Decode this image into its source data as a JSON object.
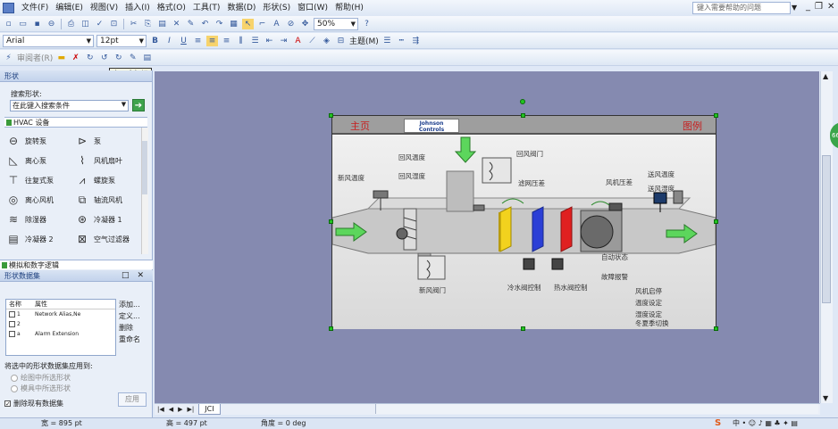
{
  "menubar": {
    "items": [
      "文件(F)",
      "编辑(E)",
      "视图(V)",
      "插入(I)",
      "格式(O)",
      "工具(T)",
      "数据(D)",
      "形状(S)",
      "窗口(W)",
      "帮助(H)"
    ],
    "help_placeholder": "键入需要帮助的问题"
  },
  "toolbar": {
    "zoom": "50%",
    "font": "Arial",
    "font_size": "12pt",
    "theme_label": "主题(M)",
    "review_label": "审阅者(R)",
    "tooltip": "上一个标记"
  },
  "shapes_pane": {
    "title": "形状",
    "search_label": "搜索形状:",
    "search_placeholder": "在此键入搜索条件",
    "stencil_title": "HVAC 设备",
    "items": [
      "旋转泵",
      "泵",
      "离心泵",
      "风机扇叶",
      "往复式泵",
      "螺旋泵",
      "离心风机",
      "轴流风机",
      "除湿器",
      "冷凝器 1",
      "冷凝器 2",
      "空气过滤器"
    ],
    "logic_title": "模拟和数字逻辑"
  },
  "datasets_pane": {
    "title": "形状数据集",
    "col_name": "名称",
    "col_prop": "属性",
    "rows": [
      {
        "name": "1",
        "prop": "Network Alias,Ne"
      },
      {
        "name": "2",
        "prop": ""
      },
      {
        "name": "a",
        "prop": "Alarm Extension"
      }
    ],
    "actions": [
      "添加...",
      "定义...",
      "删除",
      "重命名"
    ],
    "apply_label": "将选中的形状数据集应用到:",
    "opt_selected": "绘图中所选形状",
    "opt_stencil": "模具中所选形状",
    "delete_existing": "删除现有数据集",
    "apply_button": "应用"
  },
  "sheet_tab": "JCI",
  "status": {
    "width": "宽 = 895 pt",
    "height": "高 = 497 pt",
    "angle": "角度 = 0 deg"
  },
  "diagram": {
    "home": "主页",
    "legend": "图例",
    "logo_line1": "Johnson",
    "logo_line2": "Controls",
    "labels": {
      "return_temp": "回风温度",
      "return_humidity": "回风湿度",
      "fresh_temp": "新风温度",
      "return_damper": "回风阀门",
      "filter_dp": "滤网压差",
      "fan_dp": "风机压差",
      "supply_temp": "送风温度",
      "supply_humidity": "送风湿度",
      "auto_status": "自动状态",
      "fault_alarm": "故障报警",
      "fresh_damper": "新风阀门",
      "cold_valve": "冷水阀控制",
      "hot_valve": "热水阀控制",
      "fan_start": "风机启停",
      "temp_set": "温度设定",
      "humidity_set": "湿度设定",
      "season_switch": "冬夏季切换"
    }
  },
  "colors": {
    "accent_green": "#22c422",
    "canvas": "#858ab0",
    "link_red": "#c62020"
  }
}
